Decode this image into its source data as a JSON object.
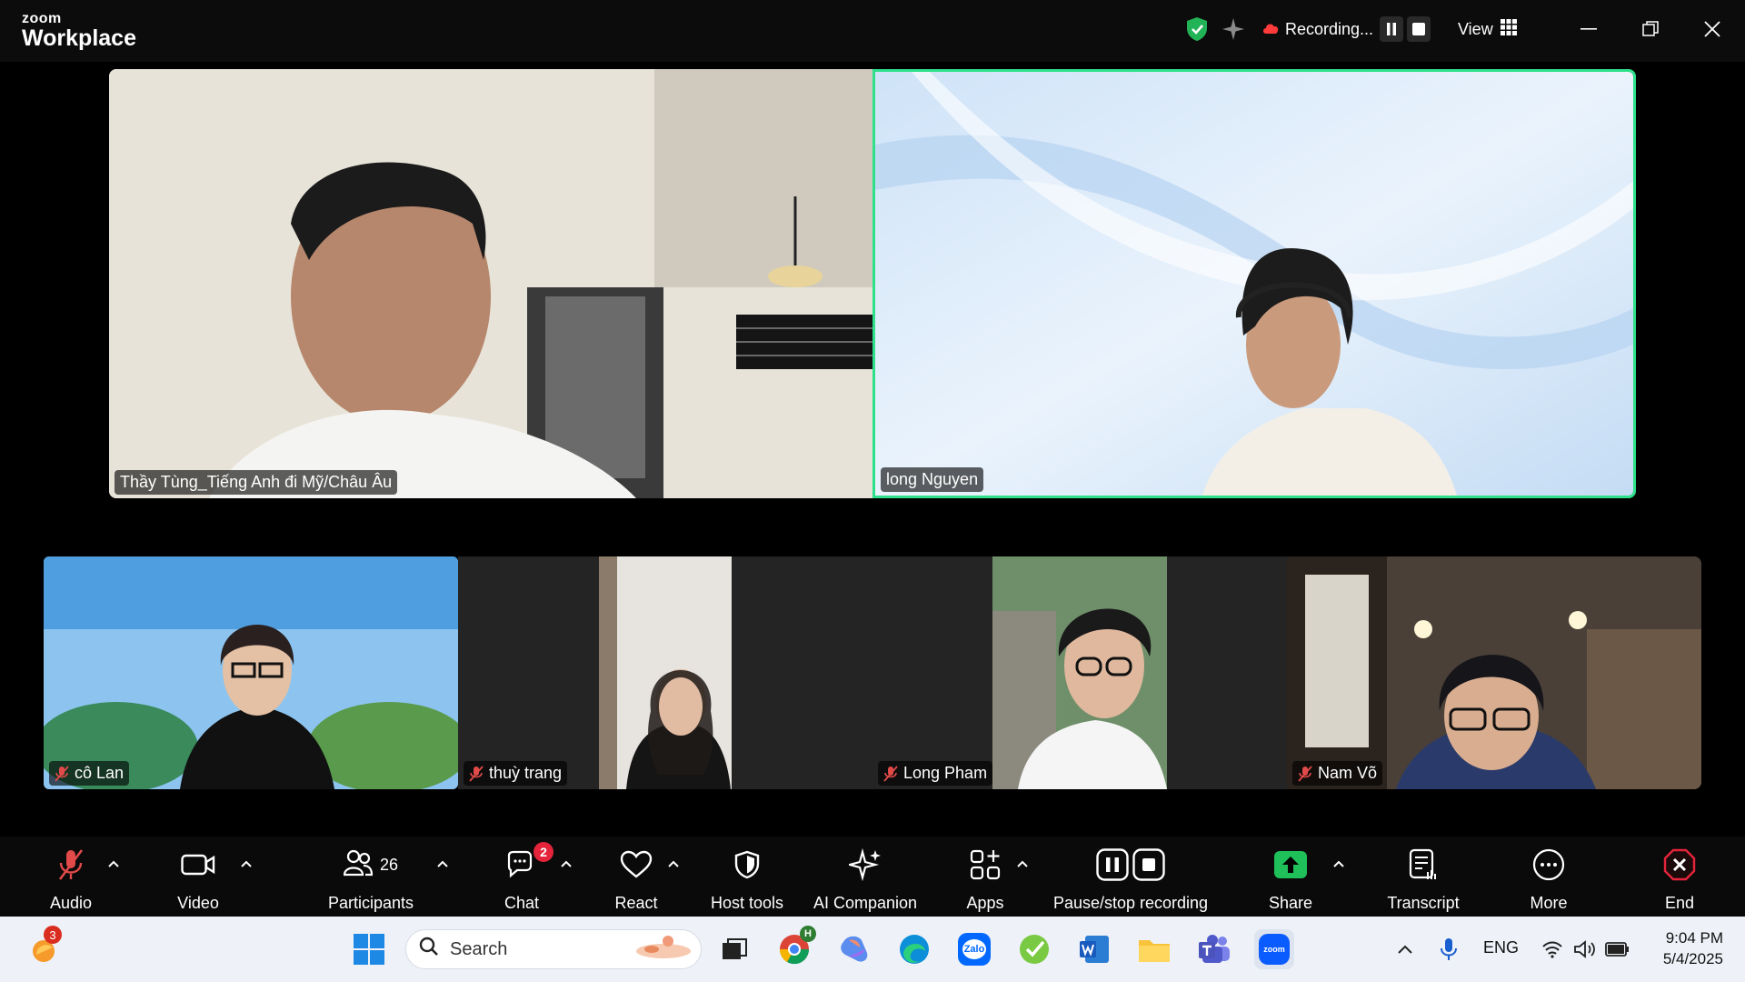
{
  "app": {
    "logo_top": "zoom",
    "logo_bottom": "Workplace"
  },
  "titlebar": {
    "recording_label": "Recording...",
    "view_label": "View"
  },
  "participants_main": [
    {
      "name": "Thầy Tùng_Tiếng Anh đi Mỹ/Châu Âu",
      "muted": false,
      "active_speaker": false
    },
    {
      "name": "long Nguyen",
      "muted": false,
      "active_speaker": true
    }
  ],
  "participants_strip": [
    {
      "name": "cô Lan",
      "muted": true
    },
    {
      "name": "thuỳ trang",
      "muted": true
    },
    {
      "name": "Long Pham",
      "muted": true
    },
    {
      "name": "Nam Võ",
      "muted": true
    }
  ],
  "toolbar": {
    "audio": "Audio",
    "video": "Video",
    "participants": "Participants",
    "participants_count": "26",
    "chat": "Chat",
    "chat_badge": "2",
    "react": "React",
    "host_tools": "Host tools",
    "ai_companion": "AI Companion",
    "apps": "Apps",
    "pause_stop": "Pause/stop recording",
    "share": "Share",
    "transcript": "Transcript",
    "more": "More",
    "end": "End"
  },
  "taskbar": {
    "widget_badge": "3",
    "search_placeholder": "Search",
    "chrome_badge": "H",
    "zalo_label": "Zalo",
    "zoom_label": "zoom",
    "language": "ENG",
    "time": "9:04 PM",
    "date": "5/4/2025"
  },
  "colors": {
    "active_speaker_border": "#2ee08a",
    "share_green": "#1fbf5a",
    "end_red": "#e5243b",
    "chat_badge": "#e5243b"
  }
}
